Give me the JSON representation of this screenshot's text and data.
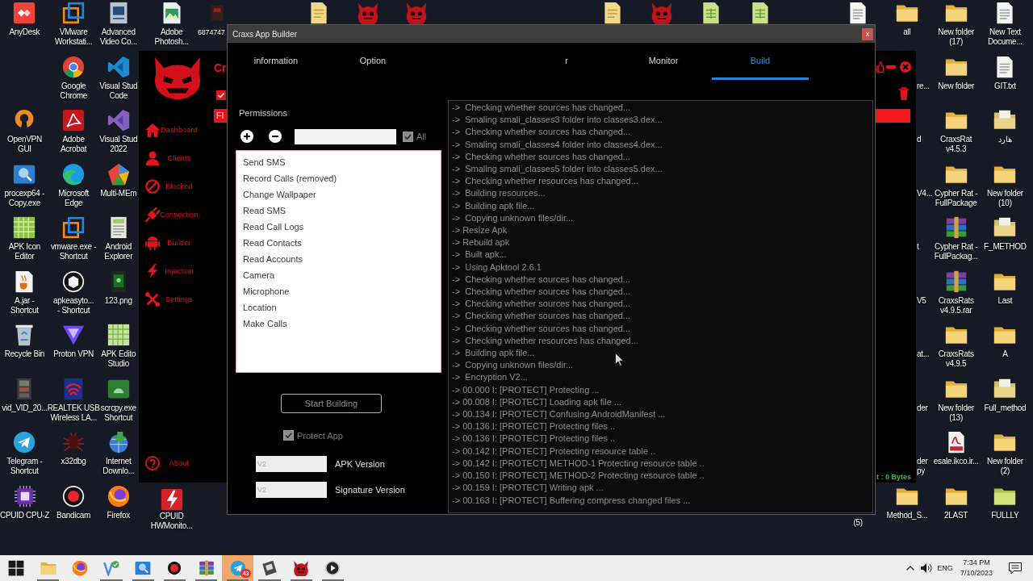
{
  "desktop": {
    "icons": [
      {
        "label": "AnyDesk",
        "kind": "anydesk"
      },
      {
        "label": "OpenVPN\nGUI",
        "kind": "openvpn"
      },
      {
        "label": "procexp64 -\nCopy.exe",
        "kind": "procexp"
      },
      {
        "label": "APK Icon\nEditor",
        "kind": "apk-grid"
      },
      {
        "label": "A.jar -\nShortcut",
        "kind": "jar"
      },
      {
        "label": "Recycle Bin",
        "kind": "recycle-bin"
      },
      {
        "label": "vid_VID_20...",
        "kind": "video-file"
      },
      {
        "label": "Telegram -\nShortcut",
        "kind": "telegram"
      },
      {
        "label": "CPUID CPU-Z",
        "kind": "cpuz"
      },
      {
        "label": "VMware\nWorkstati...",
        "kind": "vmware"
      },
      {
        "label": "Google\nChrome",
        "kind": "chrome"
      },
      {
        "label": "Adobe\nAcrobat",
        "kind": "acrobat"
      },
      {
        "label": "Microsoft\nEdge",
        "kind": "edge"
      },
      {
        "label": "vmware.exe -\nShortcut",
        "kind": "vmware"
      },
      {
        "label": "apkeasyto...\n- Shortcut",
        "kind": "apkeasy"
      },
      {
        "label": "Proton VPN",
        "kind": "protonvpn"
      },
      {
        "label": "REALTEK USB\nWireless LA...",
        "kind": "realtek"
      },
      {
        "label": "x32dbg",
        "kind": "x32dbg"
      },
      {
        "label": "Bandicam",
        "kind": "bandicam"
      },
      {
        "label": "Advanced\nVideo Co...",
        "kind": "video-converter"
      },
      {
        "label": "Visual Stud\nCode",
        "kind": "vscode"
      },
      {
        "label": "Visual Stud\n2022",
        "kind": "visual-studio"
      },
      {
        "label": "Multi-MEm",
        "kind": "multimem"
      },
      {
        "label": "Android\nExplorer",
        "kind": "android-explorer"
      },
      {
        "label": "123.png",
        "kind": "image"
      },
      {
        "label": "APK Edito\nStudio",
        "kind": "apk-grid-light"
      },
      {
        "label": "scrcpy.exe\nShortcut",
        "kind": "scrcpy"
      },
      {
        "label": "Internet\nDownlo...",
        "kind": "idm"
      },
      {
        "label": "Firefox",
        "kind": "firefox"
      },
      {
        "label": "Adobe\nPhotosh...",
        "kind": "photoshop"
      },
      {
        "label": "CPUID\nHWMonito...",
        "kind": "hwmonitor"
      },
      {
        "label": "6874747",
        "kind": "dark-app"
      },
      {
        "kind": "note-file"
      },
      {
        "kind": "devil"
      },
      {
        "kind": "devil"
      },
      {
        "kind": "note-file"
      },
      {
        "kind": "devil"
      },
      {
        "kind": "green-file"
      },
      {
        "kind": "green-file"
      },
      {
        "kind": "text-file"
      },
      {
        "label": "(5)"
      },
      {
        "label": "all",
        "kind": "folder"
      },
      {
        "label": "re..."
      },
      {
        "label": "d"
      },
      {
        "label": "V4..."
      },
      {
        "label": "t"
      },
      {
        "label": "V5"
      },
      {
        "label": "at..."
      },
      {
        "label": "der"
      },
      {
        "label": "der\npy"
      },
      {
        "label": "Method_S...",
        "kind": "folder"
      },
      {
        "label": "New folder\n(17)",
        "kind": "folder"
      },
      {
        "label": "New folder",
        "kind": "folder"
      },
      {
        "label": "CraxsRat\nv4.5.3",
        "kind": "folder"
      },
      {
        "label": "Cypher Rat -\nFullPackage",
        "kind": "folder"
      },
      {
        "label": "Cypher Rat -\nFullPackag...",
        "kind": "archive"
      },
      {
        "label": "CraxsRats\nv4.9.5.rar",
        "kind": "archive"
      },
      {
        "label": "CraxsRats\nv4.9.5",
        "kind": "folder"
      },
      {
        "label": "New folder\n(13)",
        "kind": "folder"
      },
      {
        "label": "esale.ikco.ir...",
        "kind": "pdf"
      },
      {
        "label": "2LAST",
        "kind": "folder"
      },
      {
        "label": "New Text\nDocume...",
        "kind": "text-file"
      },
      {
        "label": "GIT.txt",
        "kind": "text-file"
      },
      {
        "label": "هارد",
        "kind": "folder-doc"
      },
      {
        "label": "New folder\n(10)",
        "kind": "folder"
      },
      {
        "label": "F_METHOD",
        "kind": "folder-doc"
      },
      {
        "label": "Last",
        "kind": "folder"
      },
      {
        "label": "A",
        "kind": "folder"
      },
      {
        "label": "Full_method",
        "kind": "folder-doc"
      },
      {
        "label": "New folder\n(2)",
        "kind": "folder"
      },
      {
        "label": "FULLLY",
        "kind": "green-folder"
      }
    ]
  },
  "main_window": {
    "title": "Cr",
    "toggle": {
      "checked": true
    },
    "button": "Fl",
    "nav": [
      {
        "label": "Dashboard",
        "kind": "home"
      },
      {
        "label": "Clients",
        "kind": "person"
      },
      {
        "label": "Blocked",
        "kind": "blocked"
      },
      {
        "label": "Connection",
        "kind": "plug"
      },
      {
        "label": "Builder",
        "kind": "robot"
      },
      {
        "label": "Injection",
        "kind": "lightning"
      },
      {
        "label": "Settings",
        "kind": "tools"
      }
    ],
    "footer_item": {
      "label": "About",
      "kind": "help"
    },
    "status": "t : 0 Bytes"
  },
  "builder": {
    "title": "Craxs App Builder",
    "close": "x",
    "tabs": [
      {
        "label": "information",
        "selected": false
      },
      {
        "label": "Option",
        "selected": false
      },
      {
        "label": "r",
        "selected": false
      },
      {
        "label": "Monitor",
        "selected": false
      },
      {
        "label": "Build",
        "selected": true
      }
    ],
    "permissions": {
      "title": "Permissions",
      "all": {
        "label": "All",
        "checked": true
      },
      "items": [
        {
          "label": "Send SMS",
          "selected": false
        },
        {
          "label": "Record Calls (removed)",
          "selected": false
        },
        {
          "label": "Change Wallpaper",
          "selected": false
        },
        {
          "label": "Read SMS",
          "selected": false
        },
        {
          "label": "Read Call Logs",
          "selected": false
        },
        {
          "label": "Read Contacts",
          "selected": false
        },
        {
          "label": "Read Accounts",
          "selected": false
        },
        {
          "label": "Camera",
          "selected": false
        },
        {
          "label": "Microphone",
          "selected": false
        },
        {
          "label": "Location",
          "selected": false
        },
        {
          "label": "Make Calls",
          "selected": false
        }
      ]
    },
    "start_button": "Start Building",
    "protect": {
      "label": "Protect App",
      "checked": true
    },
    "fields": [
      {
        "value": "V2",
        "label": "APK Version"
      },
      {
        "value": "V2",
        "label": "Signature Version"
      }
    ],
    "log": [
      "->  Checking whether sources has changed...",
      "->  Smaling smali_classes3 folder into classes3.dex...",
      "->  Checking whether sources has changed...",
      "->  Smaling smali_classes4 folder into classes4.dex...",
      "->  Checking whether sources has changed...",
      "->  Smaling smali_classes5 folder into classes5.dex...",
      "->  Checking whether resources has changed...",
      "->  Building resources...",
      "->  Building apk file...",
      "->  Copying unknown files/dir...",
      "-> Resize Apk",
      "-> Rebuild apk",
      "->  Built apk...",
      "->  Using Apktool 2.6.1",
      "->  Checking whether sources has changed...",
      "->  Checking whether sources has changed...",
      "->  Checking whether sources has changed...",
      "->  Checking whether sources has changed...",
      "->  Checking whether sources has changed...",
      "->  Checking whether resources has changed...",
      "->  Building apk file...",
      "->  Copying unknown files/dir...",
      "->  Encryption V2...",
      "-> 00.000 I: [PROTECT] Protecting ...",
      "-> 00.008 I: [PROTECT] Loading apk file ...",
      "-> 00.134 I: [PROTECT] Confusing AndroidManifest ...",
      "-> 00.136 I: [PROTECT] Protecting files ..",
      "-> 00.136 I: [PROTECT] Protecting files ..",
      "-> 00.142 I: [PROTECT] Protecting resource table ..",
      "-> 00.142 I: [PROTECT] METHOD-1 Protecting resource table ..",
      "-> 00.150 I: [PROTECT] METHOD-2 Protecting resource table ..",
      "-> 00.159 I: [PROTECT] Writing apk ...",
      "-> 00.163 I: [PROTECT] Buffering compress changed files ..."
    ]
  },
  "taskbar": {
    "apps": [
      {
        "kind": "start",
        "running": false,
        "attention": false
      },
      {
        "kind": "folder",
        "running": true,
        "attention": false
      },
      {
        "kind": "firefox",
        "running": false,
        "attention": false
      },
      {
        "kind": "v-check",
        "running": true,
        "attention": false
      },
      {
        "kind": "procexp",
        "running": true,
        "attention": false
      },
      {
        "kind": "bandicam",
        "running": true,
        "attention": false
      },
      {
        "kind": "archive",
        "running": true,
        "attention": false
      },
      {
        "kind": "telegram",
        "running": true,
        "attention": true,
        "badge": "43"
      },
      {
        "kind": "tile",
        "running": true,
        "attention": false
      },
      {
        "kind": "devil",
        "running": true,
        "attention": false
      },
      {
        "kind": "play",
        "running": true,
        "attention": false
      }
    ],
    "tray": {
      "language": "ENG",
      "time": "7:34 PM",
      "date": "7/10/2023"
    }
  }
}
